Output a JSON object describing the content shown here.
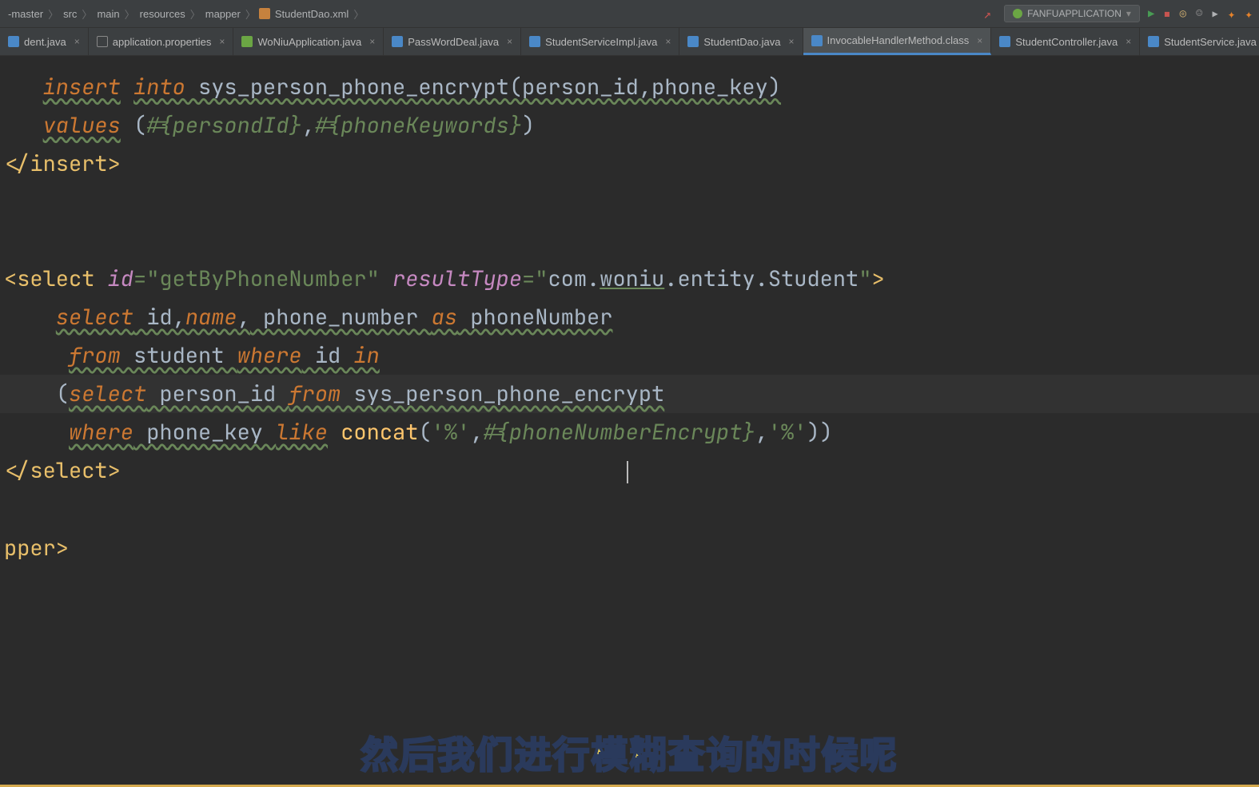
{
  "breadcrumb": {
    "items": [
      "-master",
      "src",
      "main",
      "resources",
      "mapper",
      "StudentDao.xml"
    ]
  },
  "runConfig": {
    "label": "FANFUAPPLICATION"
  },
  "tabs": [
    {
      "label": "dent.java",
      "icon": "java",
      "active": false
    },
    {
      "label": "application.properties",
      "icon": "prop",
      "active": false
    },
    {
      "label": "WoNiuApplication.java",
      "icon": "green",
      "active": false
    },
    {
      "label": "PassWordDeal.java",
      "icon": "java",
      "active": false
    },
    {
      "label": "StudentServiceImpl.java",
      "icon": "java",
      "active": false
    },
    {
      "label": "StudentDao.java",
      "icon": "java",
      "active": false
    },
    {
      "label": "InvocableHandlerMethod.class",
      "icon": "java",
      "active": true
    },
    {
      "label": "StudentController.java",
      "icon": "java",
      "active": false
    },
    {
      "label": "StudentService.java",
      "icon": "java",
      "active": false
    }
  ],
  "code": {
    "l1_insert": "insert",
    "l1_into": "into",
    "l1_sql": " sys_person_phone_encrypt(person_id,phone_key)",
    "l2_values": "values",
    "l2_open": " (",
    "l2_p1": "#{persondId}",
    "l2_comma": ",",
    "l2_p2": "#{phoneKeywords}",
    "l2_close": ")",
    "l3_insert_close": "</insert>",
    "l5_open": "<select ",
    "l5_id_attr": "id",
    "l5_eq1": "=",
    "l5_id_val": "\"getByPhoneNumber\"",
    "l5_rt_attr": "resultType",
    "l5_eq2": "=",
    "l5_rt_val_q": "\"",
    "l5_rt_com": "com.",
    "l5_rt_woniu": "woniu",
    "l5_rt_rest": ".entity.Student",
    "l5_close": ">",
    "l6_select": "select",
    "l6_id": " id,",
    "l6_name": "name",
    "l6_comma": ",",
    "l6_phone": " phone_number ",
    "l6_as": "as",
    "l6_alias": " phoneNumber",
    "l7_from": "from",
    "l7_student": " student ",
    "l7_where": "where",
    "l7_id": " id ",
    "l7_in": "in",
    "l8_open": "(",
    "l8_select": "select",
    "l8_person": " person_id ",
    "l8_from": "from",
    "l8_table": " sys_person_phone_encrypt",
    "l9_where": "where",
    "l9_pk": " phone_key ",
    "l9_like": "like",
    "l9_concat": " concat",
    "l9_open": "(",
    "l9_pct1": "'%'",
    "l9_c1": ",",
    "l9_param": "#{phoneNumberEncrypt}",
    "l9_c2": ",",
    "l9_pct2": "'%'",
    "l9_close": "))",
    "l10_select_close": "</select>",
    "l12_mapper": "pper>"
  },
  "subtitle": "然后我们进行模糊查询的时候呢"
}
